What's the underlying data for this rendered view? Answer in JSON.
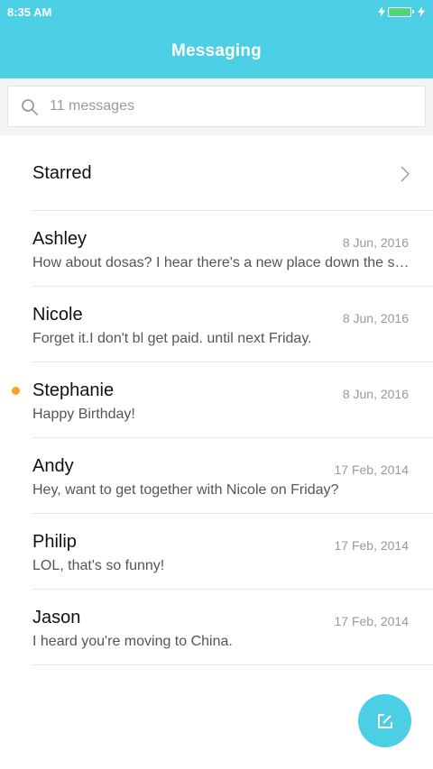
{
  "status_bar": {
    "time": "8:35 AM",
    "battery_level": 1.0
  },
  "header": {
    "title": "Messaging"
  },
  "search": {
    "placeholder": "11 messages",
    "icon": "search-icon"
  },
  "starred": {
    "label": "Starred",
    "icon": "chevron-right-icon"
  },
  "messages": [
    {
      "name": "Ashley",
      "date": "8 Jun, 2016",
      "preview": "How about dosas? I hear there's a new place down the st…",
      "unread": false
    },
    {
      "name": "Nicole",
      "date": "8 Jun, 2016",
      "preview": "Forget it.I don't bl get paid. until next Friday.",
      "unread": false
    },
    {
      "name": "Stephanie",
      "date": "8 Jun, 2016",
      "preview": "Happy Birthday!",
      "unread": true
    },
    {
      "name": "Andy",
      "date": "17 Feb, 2014",
      "preview": "Hey, want to get together with Nicole on Friday?",
      "unread": false
    },
    {
      "name": "Philip",
      "date": "17 Feb, 2014",
      "preview": "LOL, that's so funny!",
      "unread": false
    },
    {
      "name": "Jason",
      "date": "17 Feb, 2014",
      "preview": "I heard you're moving to China.",
      "unread": false
    }
  ],
  "compose_button": {
    "icon": "compose-icon"
  },
  "colors": {
    "accent": "#4ccfe4",
    "unread_dot": "#f5a623",
    "battery": "#4cd964"
  }
}
